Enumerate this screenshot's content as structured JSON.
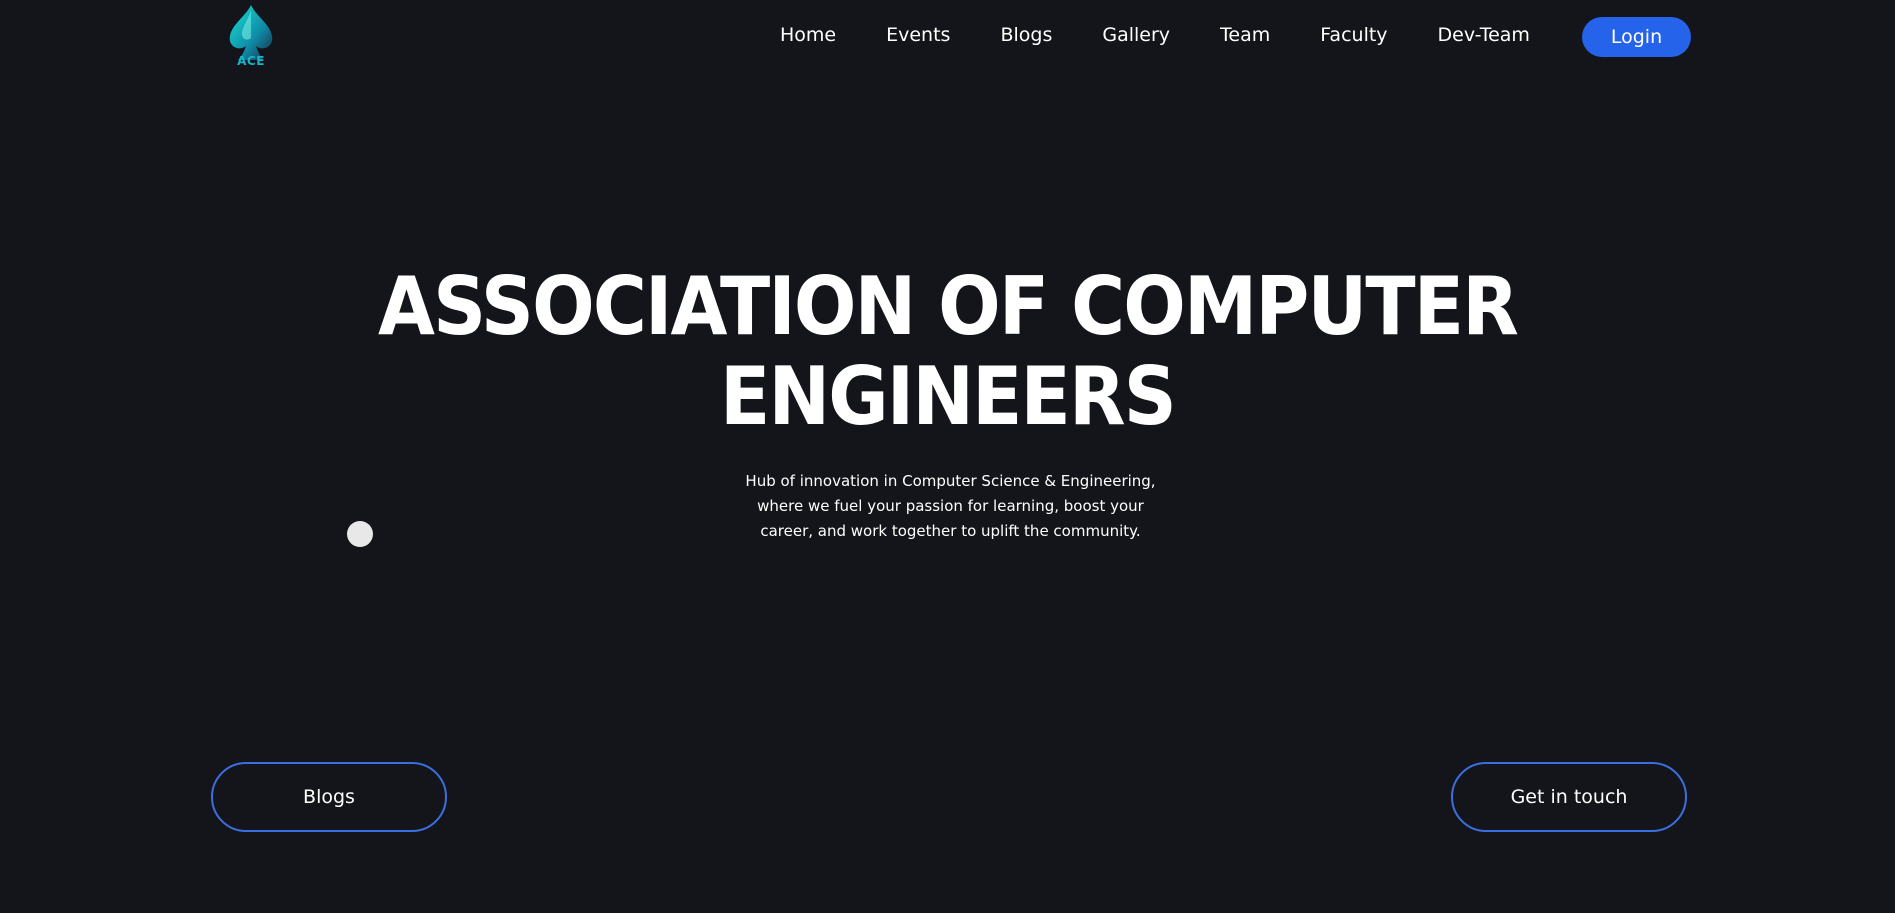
{
  "brand": {
    "logo_text": "ACE",
    "logo_icon": "spade-icon",
    "accent_color": "#15b6c8"
  },
  "nav": {
    "items": [
      "Home",
      "Events",
      "Blogs",
      "Gallery",
      "Team",
      "Faculty",
      "Dev-Team"
    ],
    "login_label": "Login",
    "login_color": "#2563eb"
  },
  "hero": {
    "title_line1": "ASSOCIATION OF COMPUTER",
    "title_line2": "ENGINEERS",
    "subtitle": "Hub of innovation in Computer Science & Engineering, where we fuel your passion for learning, boost your career, and work together to uplift the community."
  },
  "cta": {
    "left_label": "Blogs",
    "right_label": "Get in touch",
    "border_color": "#3b6fe0"
  },
  "theme": {
    "background": "#14151b",
    "text": "#ffffff"
  }
}
